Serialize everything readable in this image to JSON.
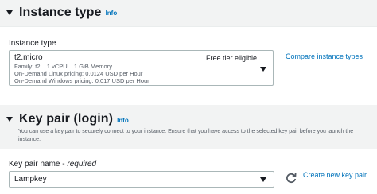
{
  "instance_type_section": {
    "title": "Instance type",
    "info": "Info",
    "field_label": "Instance type",
    "selected": {
      "name": "t2.micro",
      "family_line": "Family: t2    1 vCPU    1 GiB Memory",
      "linux_pricing": "On-Demand Linux pricing: 0.0124 USD per Hour",
      "windows_pricing": "On-Demand Windows pricing: 0.017 USD per Hour",
      "badge": "Free tier eligible"
    },
    "compare_link": "Compare instance types"
  },
  "key_pair_section": {
    "title": "Key pair (login)",
    "info": "Info",
    "description": "You can use a key pair to securely connect to your instance. Ensure that you have access to the selected key pair before you launch the instance.",
    "field_label": "Key pair name - ",
    "field_required": "required",
    "selected": "Lampkey",
    "create_link": "Create new key pair"
  },
  "colors": {
    "link": "#0073bb",
    "header_bg": "#f2f3f3",
    "border": "#aab7b8"
  },
  "icons": [
    "caret-down-icon",
    "dropdown-arrow-icon",
    "refresh-icon"
  ]
}
